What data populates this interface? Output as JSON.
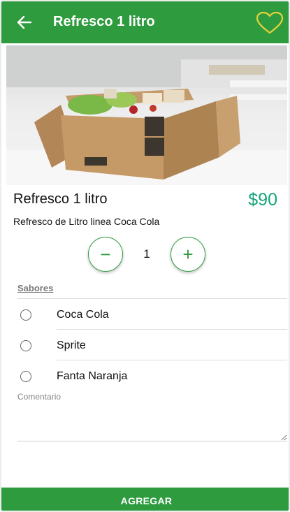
{
  "app_bar": {
    "title": "Refresco 1 litro",
    "back_icon": "arrow-left-icon",
    "favorite_icon": "heart-outline-icon",
    "color": "#2e9b3e",
    "favorite_color": "#e3d33a"
  },
  "product": {
    "image": "delivery-box-photo",
    "name": "Refresco 1 litro",
    "price": "$90",
    "price_color": "#16a47a",
    "description": "Refresco de Litro linea Coca Cola"
  },
  "quantity": {
    "minus_label": "−",
    "value": "1",
    "plus_label": "+"
  },
  "flavors": {
    "label": "Sabores",
    "options": [
      {
        "label": "Coca Cola",
        "selected": false
      },
      {
        "label": "Sprite",
        "selected": false
      },
      {
        "label": "Fanta Naranja",
        "selected": false
      }
    ]
  },
  "comment": {
    "label": "Comentario",
    "value": ""
  },
  "footer": {
    "button_label": "AGREGAR"
  }
}
